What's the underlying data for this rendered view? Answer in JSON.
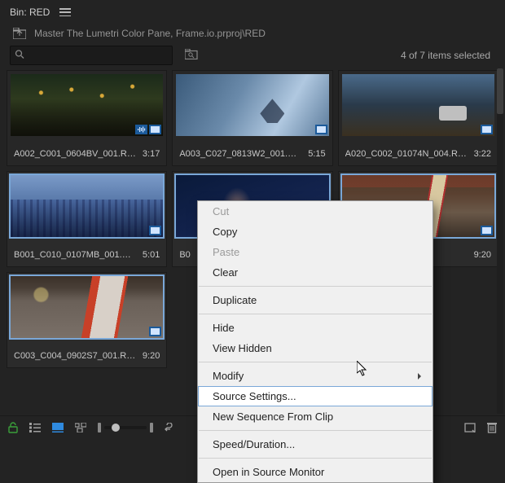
{
  "title": "Bin: RED",
  "path": "Master The Lumetri Color Pane, Frame.io.prproj\\RED",
  "search": {
    "placeholder": ""
  },
  "selection_status": "4 of 7 items selected",
  "clips": [
    {
      "name": "A002_C001_0604BV_001.R3D",
      "dur": "3:17",
      "thumb": "t1",
      "selected": false,
      "audio": true
    },
    {
      "name": "A003_C027_0813W2_001.R3D",
      "dur": "5:15",
      "thumb": "t2",
      "selected": false,
      "audio": false
    },
    {
      "name": "A020_C002_01074N_004.R3D",
      "dur": "3:22",
      "thumb": "t3",
      "selected": false,
      "audio": false
    },
    {
      "name": "B001_C010_0107MB_001.R3D",
      "dur": "5:01",
      "thumb": "t4",
      "selected": true,
      "audio": false
    },
    {
      "name": "B0",
      "dur": "",
      "thumb": "t5",
      "selected": true,
      "audio": false
    },
    {
      "name": "",
      "dur": "9:20",
      "thumb": "t6",
      "selected": true,
      "audio": false
    },
    {
      "name": "C003_C004_0902S7_001.R3D",
      "dur": "9:20",
      "thumb": "t7",
      "selected": true,
      "audio": false
    }
  ],
  "context_menu": {
    "cut": "Cut",
    "copy": "Copy",
    "paste": "Paste",
    "clear": "Clear",
    "duplicate": "Duplicate",
    "hide": "Hide",
    "view_hidden": "View Hidden",
    "modify": "Modify",
    "source_settings": "Source Settings...",
    "new_seq": "New Sequence From Clip",
    "speed_dur": "Speed/Duration...",
    "open_src": "Open in Source Monitor"
  }
}
